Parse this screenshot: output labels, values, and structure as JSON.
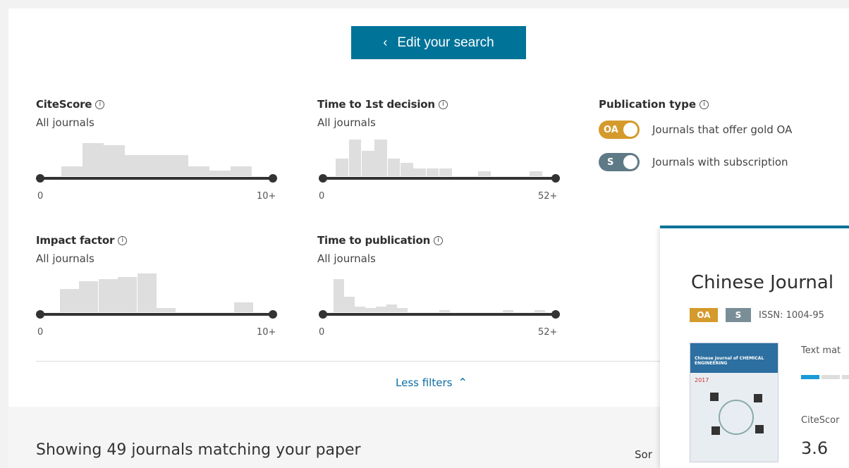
{
  "edit_button": {
    "label": "Edit your search",
    "icon": "chevron-left-icon"
  },
  "filters": {
    "citescore": {
      "title": "CiteScore",
      "subtitle": "All journals",
      "min_label": "0",
      "max_label": "10+",
      "range": [
        0,
        10
      ]
    },
    "time_first_decision": {
      "title": "Time to 1st decision",
      "subtitle": "All journals",
      "min_label": "0",
      "max_label": "52+",
      "range": [
        0,
        52
      ]
    },
    "impact_factor": {
      "title": "Impact factor",
      "subtitle": "All journals",
      "min_label": "0",
      "max_label": "10+",
      "range": [
        0,
        10
      ]
    },
    "time_publication": {
      "title": "Time to publication",
      "subtitle": "All journals",
      "min_label": "0",
      "max_label": "52+",
      "range": [
        0,
        52
      ]
    }
  },
  "histograms": {
    "citescore": [
      0.0,
      0.25,
      0.85,
      0.8,
      0.55,
      0.55,
      0.55,
      0.25,
      0.15,
      0.25,
      0.0
    ],
    "time_first_decision": [
      0.0,
      0.45,
      0.95,
      0.65,
      0.95,
      0.45,
      0.35,
      0.2,
      0.2,
      0.2,
      0.0,
      0.0,
      0.12,
      0.0,
      0.0,
      0.0,
      0.12,
      0.0
    ],
    "impact_factor": [
      0.0,
      0.6,
      0.8,
      0.85,
      0.9,
      1.0,
      0.1,
      0.0,
      0.0,
      0.0,
      0.25,
      0.0
    ],
    "time_publication": [
      0.0,
      0.85,
      0.4,
      0.15,
      0.1,
      0.15,
      0.2,
      0.1,
      0.0,
      0.0,
      0.0,
      0.05,
      0.0,
      0.0,
      0.0,
      0.0,
      0.0,
      0.05,
      0.0,
      0.0,
      0.05,
      0.0
    ]
  },
  "publication_type": {
    "title": "Publication type",
    "options": [
      {
        "badge": "OA",
        "label": "Journals that offer gold OA",
        "color": "#d59a2c"
      },
      {
        "badge": "S",
        "label": "Journals with subscription",
        "color": "#5f7a87"
      }
    ]
  },
  "less_filters": "Less filters",
  "results": {
    "showing": "Showing 49 journals matching your paper",
    "sort_label": "Sor"
  },
  "card": {
    "title": "Chinese Journal",
    "badge_oa": "OA",
    "badge_s": "S",
    "issn": "ISSN: 1004-95",
    "text_match_label": "Text mat",
    "text_match_level": 0.25,
    "citescore_label": "CiteScor",
    "citescore_value": "3.6",
    "cover": {
      "title": "Chinese Journal of CHEMICAL ENGINEERING",
      "year": "2017"
    }
  },
  "colors": {
    "primary": "#007398",
    "oa": "#d59a2c",
    "subscription": "#7a8e97",
    "link": "#0b6ea0"
  }
}
